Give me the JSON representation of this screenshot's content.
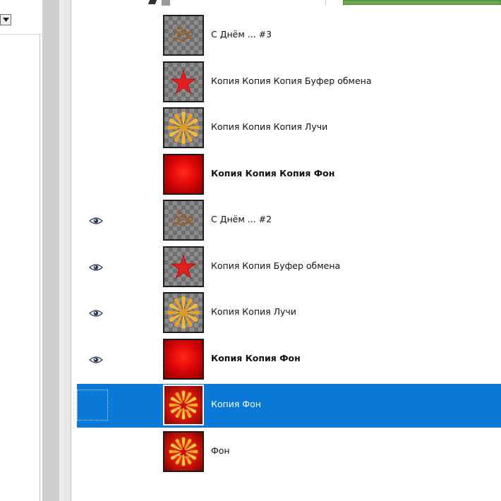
{
  "left_panel": {
    "dropdown_icon": "chevron-down-icon"
  },
  "layers": [
    {
      "name": "С Днём ... #3",
      "bold": false,
      "visible": false,
      "selected": false,
      "thumbnail": "text-on-transparent"
    },
    {
      "name": "Копия Копия Копия Буфер обмена",
      "bold": false,
      "visible": false,
      "selected": false,
      "thumbnail": "star-on-transparent"
    },
    {
      "name": "Копия Копия Копия Лучи",
      "bold": false,
      "visible": false,
      "selected": false,
      "thumbnail": "rays-on-transparent"
    },
    {
      "name": "Копия Копия Копия Фон",
      "bold": true,
      "visible": false,
      "selected": false,
      "thumbnail": "red-gradient"
    },
    {
      "name": "С Днём ... #2",
      "bold": false,
      "visible": true,
      "selected": false,
      "thumbnail": "text-on-transparent"
    },
    {
      "name": "Копия Копия Буфер обмена",
      "bold": false,
      "visible": true,
      "selected": false,
      "thumbnail": "star-on-transparent"
    },
    {
      "name": "Копия Копия Лучи",
      "bold": false,
      "visible": true,
      "selected": false,
      "thumbnail": "rays-on-transparent"
    },
    {
      "name": "Копия Копия Фон",
      "bold": true,
      "visible": true,
      "selected": false,
      "thumbnail": "red-gradient"
    },
    {
      "name": "Копия Фон",
      "bold": false,
      "visible": false,
      "selected": true,
      "thumbnail": "composite"
    },
    {
      "name": "Фон",
      "bold": false,
      "visible": false,
      "selected": false,
      "thumbnail": "composite"
    }
  ],
  "colors": {
    "selection": "#0a78d7",
    "accent_green": "#6aa84f"
  }
}
